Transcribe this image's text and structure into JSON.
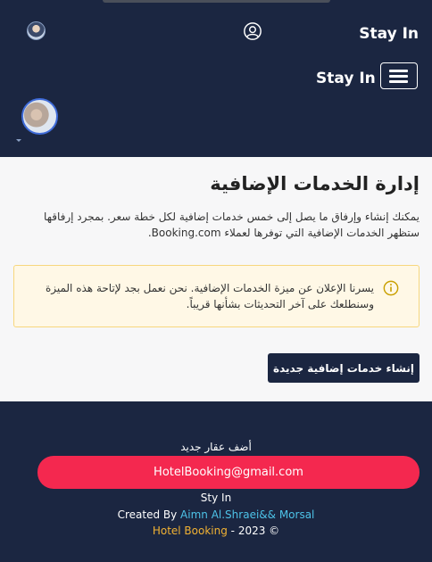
{
  "header": {
    "brand": "Stay In",
    "brand_secondary": "Stay In",
    "icons": {
      "user": "user-circle-icon",
      "menu": "hamburger-menu-icon",
      "caret": "caret-down-icon"
    }
  },
  "main": {
    "title": "إدارة الخدمات الإضافية",
    "description": "يمكنك إنشاء وإرفاق ما يصل إلى خمس خدمات إضافية لكل خطة سعر. بمجرد إرفاقها ستظهر الخدمات الإضافية التي توفرها لعملاء Booking.com.",
    "alert": {
      "text": "يسرنا الإعلان عن ميزة الخدمات الإضافية. نحن نعمل بجد لإتاحة هذه الميزة وسنطلعك على آخر التحديثات بشأنها قريباً.",
      "icon": "info-icon"
    },
    "create_button": "إنشاء خدمات إضافية جديدة"
  },
  "footer": {
    "add_property": "أضف عقار جديد",
    "email": "HotelBooking@gmail.com",
    "site_name": "Sty In",
    "created_by_prefix": "Created By ",
    "created_by_names": "Aimn Al.Shraei&& Morsal",
    "copyright_brand": "Hotel Booking",
    "copyright_rest": " - 2023 ©"
  },
  "colors": {
    "navy": "#1b2641",
    "accent": "#f4284f",
    "link": "#4dc3e8",
    "gold": "#f2b233"
  }
}
